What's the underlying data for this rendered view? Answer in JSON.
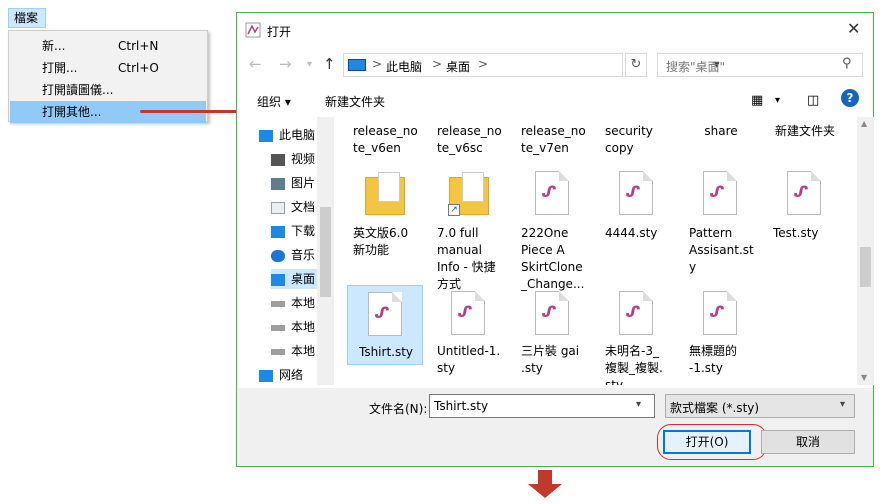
{
  "app_menu": {
    "title": "檔案",
    "items": [
      {
        "label": "新...",
        "shortcut": "Ctrl+N"
      },
      {
        "label": "打開...",
        "shortcut": "Ctrl+O"
      },
      {
        "label": "打開讀圖儀...",
        "shortcut": ""
      },
      {
        "label": "打開其他...",
        "shortcut": ""
      }
    ]
  },
  "dialog": {
    "title": "打开",
    "address": {
      "crumbs": [
        "此电脑",
        "桌面"
      ],
      "separator": ">"
    },
    "search_placeholder": "搜索\"桌面\"",
    "toolbar": {
      "organize": "组织 ▾",
      "new_folder": "新建文件夹"
    },
    "nav_items": [
      {
        "label": "此电脑",
        "icon": "computer-icon"
      },
      {
        "label": "视频",
        "icon": "video-icon"
      },
      {
        "label": "图片",
        "icon": "picture-icon"
      },
      {
        "label": "文档",
        "icon": "document-icon"
      },
      {
        "label": "下载",
        "icon": "download-icon"
      },
      {
        "label": "音乐",
        "icon": "music-icon"
      },
      {
        "label": "桌面",
        "icon": "desktop-icon"
      },
      {
        "label": "本地",
        "icon": "drive-icon"
      },
      {
        "label": "本地",
        "icon": "drive-icon"
      },
      {
        "label": "本地",
        "icon": "drive-icon"
      },
      {
        "label": "网络",
        "icon": "network-icon"
      }
    ],
    "files_row0": [
      {
        "line1": "release_no",
        "line2": "te_v6en"
      },
      {
        "line1": "release_no",
        "line2": "te_v6sc"
      },
      {
        "line1": "release_no",
        "line2": "te_v7en"
      },
      {
        "line1": "security",
        "line2": "copy"
      },
      {
        "line1": "share",
        "line2": ""
      },
      {
        "line1": "新建文件夹",
        "line2": ""
      }
    ],
    "files_row1": [
      {
        "lines": [
          "英文版6.0",
          "新功能"
        ],
        "kind": "folder"
      },
      {
        "lines": [
          "7.0 full",
          "manual",
          "Info - 快捷",
          "方式"
        ],
        "kind": "shortcut"
      },
      {
        "lines": [
          "222One",
          "Piece A",
          "SkirtClone",
          "_Change..."
        ],
        "kind": "sty"
      },
      {
        "lines": [
          "4444.sty"
        ],
        "kind": "sty"
      },
      {
        "lines": [
          "Pattern",
          "Assisant.st",
          "y"
        ],
        "kind": "sty"
      },
      {
        "lines": [
          "Test.sty"
        ],
        "kind": "sty"
      }
    ],
    "files_row2": [
      {
        "lines": [
          "Tshirt.sty"
        ],
        "kind": "sty",
        "selected": true
      },
      {
        "lines": [
          "Untitled-1.",
          "sty"
        ],
        "kind": "sty"
      },
      {
        "lines": [
          "三片裝 gai",
          ".sty"
        ],
        "kind": "sty"
      },
      {
        "lines": [
          "未明名-3_",
          "複製_複製.",
          "sty"
        ],
        "kind": "sty"
      },
      {
        "lines": [
          "無標題的",
          "-1.sty"
        ],
        "kind": "sty"
      }
    ],
    "filename_label": "文件名(N):",
    "filename_value": "Tshirt.sty",
    "filetype_value": "款式檔案 (*.sty)",
    "open_button": "打开(O)",
    "cancel_button": "取消"
  },
  "colors": {
    "accent": "#0078d7",
    "annotation": "#c0392b",
    "dialog_border": "#4caf50"
  }
}
